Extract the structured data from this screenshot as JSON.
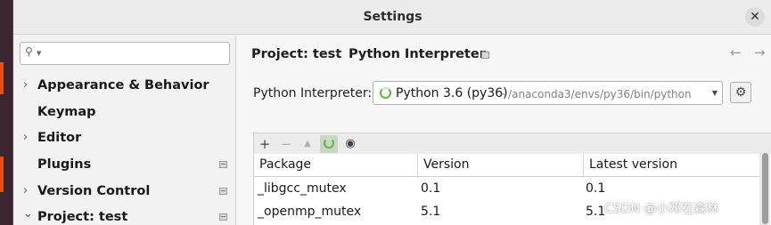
{
  "window": {
    "title": "Settings"
  },
  "sidebar": {
    "search": {
      "placeholder": ""
    },
    "items": [
      {
        "label": "Appearance & Behavior",
        "arrow": "›",
        "badge": false
      },
      {
        "label": "Keymap",
        "arrow": "",
        "badge": false
      },
      {
        "label": "Editor",
        "arrow": "›",
        "badge": false
      },
      {
        "label": "Plugins",
        "arrow": "",
        "badge": true
      },
      {
        "label": "Version Control",
        "arrow": "›",
        "badge": true
      },
      {
        "label": "Project: test",
        "arrow": "⌄",
        "badge": true
      }
    ]
  },
  "main": {
    "breadcrumb": {
      "project": "Project: test",
      "separator": "›",
      "page": "Python Interpreter"
    },
    "nav": {
      "back": "←",
      "forward": "→"
    },
    "interpreter": {
      "label": "Python Interpreter:",
      "name": "Python 3.6 (py36)",
      "path": "~/anaconda3/envs/py36/bin/python"
    },
    "toolbar": {
      "add": "+",
      "remove": "−",
      "upgrade": "▲",
      "show": "◉"
    },
    "table": {
      "columns": [
        "Package",
        "Version",
        "Latest version"
      ],
      "rows": [
        [
          "_libgcc_mutex",
          "0.1",
          "0.1"
        ],
        [
          "_openmp_mutex",
          "5.1",
          "5.1"
        ]
      ]
    }
  },
  "watermark": "CSDN @小邓在森林",
  "colors": {
    "spinner": "#62b543",
    "desktop": "#3a1f2b",
    "accent": "#e0521b"
  }
}
